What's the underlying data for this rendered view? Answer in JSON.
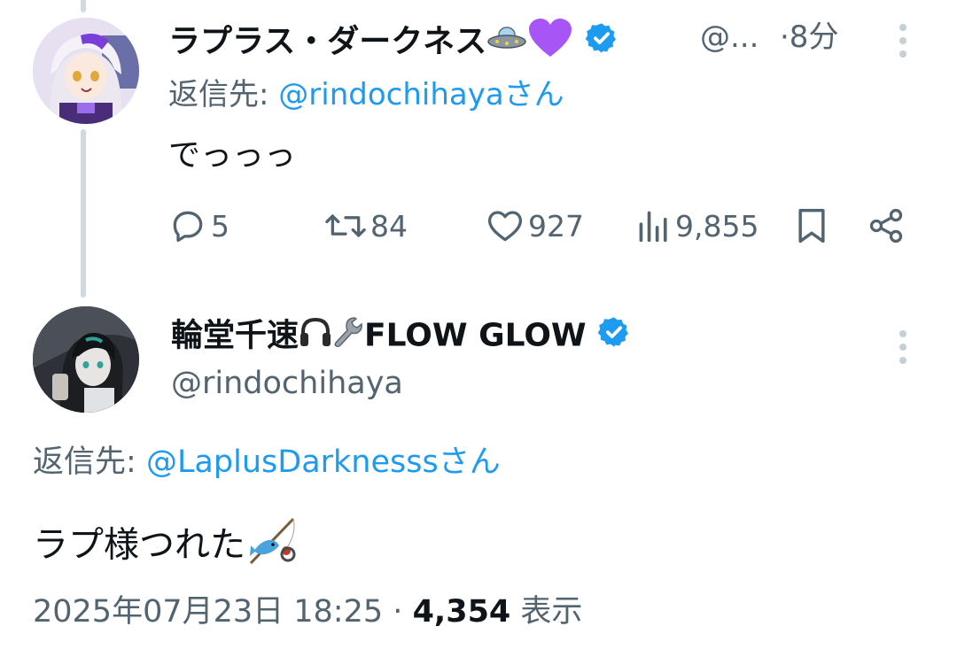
{
  "reply_tweet": {
    "display_name": "ラプラス・ダークネス",
    "name_emojis": [
      "flying-saucer",
      "purple-heart"
    ],
    "handle_truncated": "@...",
    "time_ago": "·8分",
    "reply_label": "返信先:",
    "reply_to": "@rindochihayaさん",
    "text": "でっっっ",
    "actions": {
      "replies": "5",
      "reposts": "84",
      "likes": "927",
      "views": "9,855"
    }
  },
  "main_tweet": {
    "display_name": "輪堂千速",
    "name_suffix": "FLOW GLOW",
    "name_emojis": [
      "headphones",
      "wrench"
    ],
    "handle": "@rindochihaya",
    "reply_label": "返信先:",
    "reply_to": "@LaplusDarknesssさん",
    "text": "ラプ様つれた",
    "text_emoji": "fishing-pole",
    "datetime": "2025年07月23日 18:25",
    "separator": "·",
    "view_count": "4,354",
    "view_label": "表示"
  },
  "colors": {
    "link": "#1d9bf0",
    "muted": "#536471",
    "verified": "#1d9bf0",
    "thread_line": "#cfd9de",
    "text": "#0f1419"
  }
}
